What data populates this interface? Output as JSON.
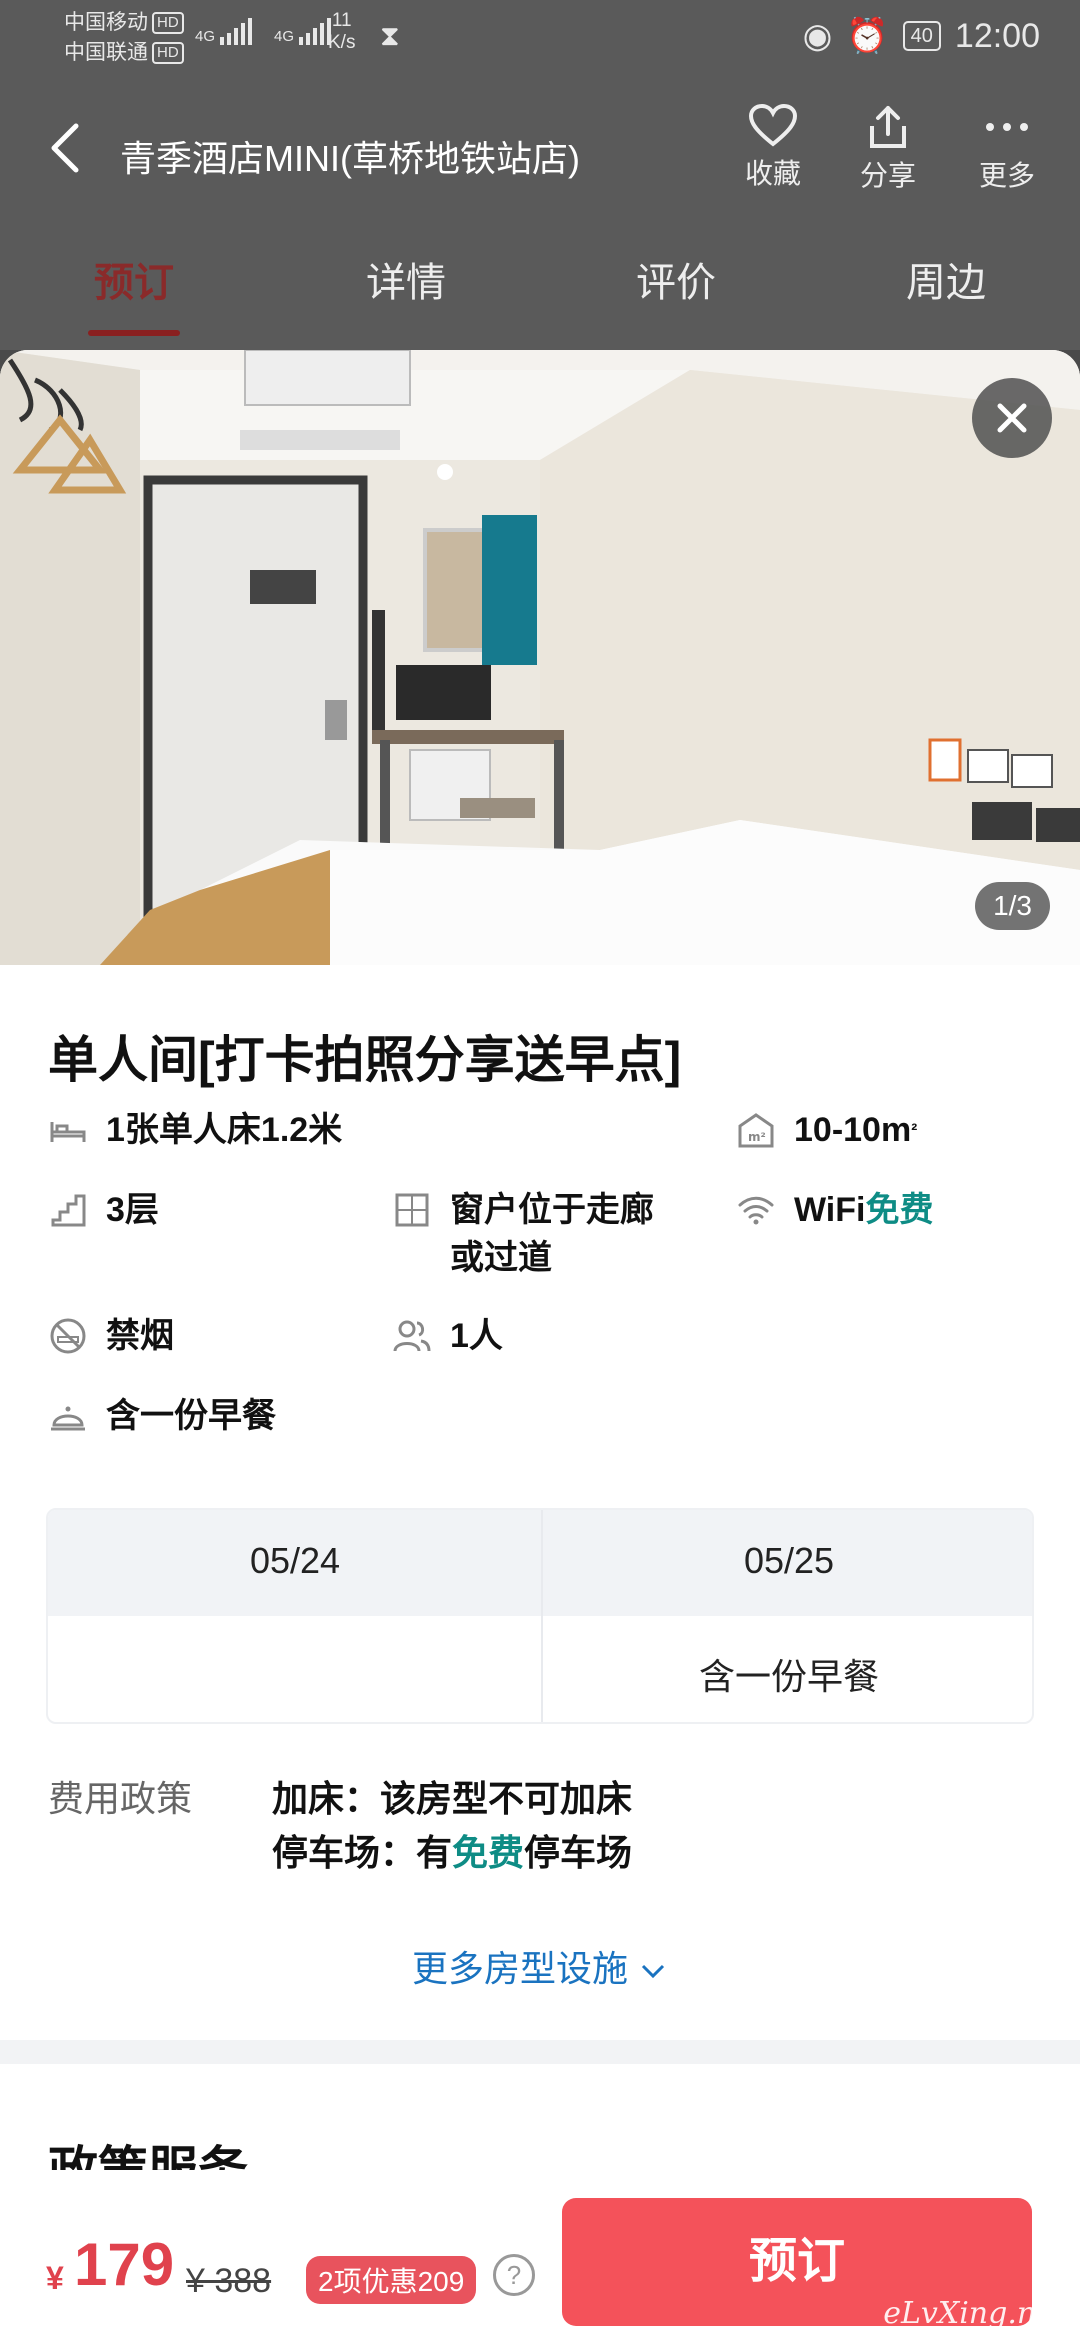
{
  "status_bar": {
    "carrier1": "中国移动",
    "carrier2": "中国联通",
    "hd": "HD",
    "net": "4G",
    "speed_value": "11",
    "speed_unit": "K/s",
    "battery": "40",
    "time": "12:00"
  },
  "header": {
    "title": "青季酒店MINI(草桥地铁站店)",
    "actions": {
      "favorite": "收藏",
      "share": "分享",
      "more": "更多"
    }
  },
  "tabs": [
    "预订",
    "详情",
    "评价",
    "周边"
  ],
  "photo": {
    "counter": "1/3"
  },
  "room": {
    "name": "单人间[打卡拍照分享送早点]",
    "bed": "1张单人床1.2米",
    "area": "10-10m",
    "area_sup": "²",
    "floor": "3层",
    "window_line1": "窗户位于走廊",
    "window_line2": "或过道",
    "wifi_label": "WiFi",
    "wifi_value": "免费",
    "smoking": "禁烟",
    "occupancy": "1人",
    "breakfast": "含一份早餐"
  },
  "dates": {
    "columns": [
      "05/24",
      "05/25"
    ],
    "rows": [
      [
        "",
        "含一份早餐"
      ]
    ]
  },
  "policy": {
    "label": "费用政策",
    "extra_bed": "加床：该房型不可加床",
    "parking_prefix": "停车场：有",
    "parking_free": "免费",
    "parking_suffix": "停车场"
  },
  "more_facilities": "更多房型设施",
  "section_title": "政策服务",
  "bottom": {
    "currency": "¥",
    "price": "179",
    "original_price": "¥ 388",
    "promo": "2项优惠209",
    "help": "?",
    "book": "预订"
  },
  "watermark": "eLvXing.net",
  "colors": {
    "accent_red": "#f4525a",
    "price_red": "#e0424d",
    "link_blue": "#1a73c0",
    "free_green": "#0e8c85"
  }
}
